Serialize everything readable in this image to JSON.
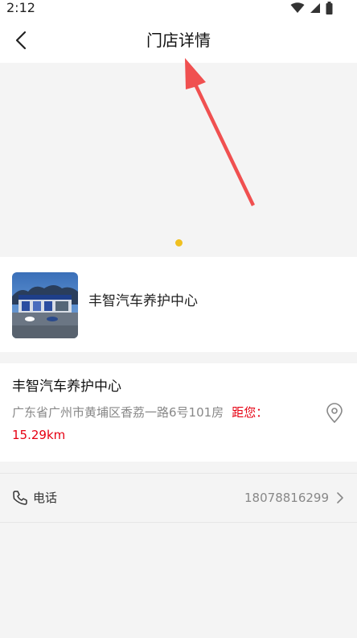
{
  "status_bar": {
    "time": "2:12"
  },
  "header": {
    "title": "门店详情",
    "back_icon": "chevron-left-icon"
  },
  "banner": {
    "indicator_color": "#f0c020"
  },
  "annotation": {
    "arrow_color": "#f05050"
  },
  "store_card": {
    "name": "丰智汽车养护中心"
  },
  "store_info": {
    "name": "丰智汽车养护中心",
    "address": "广东省广州市黄埔区香荔一路6号101房",
    "distance_label": "距您：",
    "distance_value": "15.29km",
    "location_icon": "map-pin-icon"
  },
  "phone": {
    "label": "电话",
    "number": "18078816299",
    "icon": "phone-icon"
  },
  "colors": {
    "distance": "#e60012",
    "accent": "#f0c020"
  }
}
